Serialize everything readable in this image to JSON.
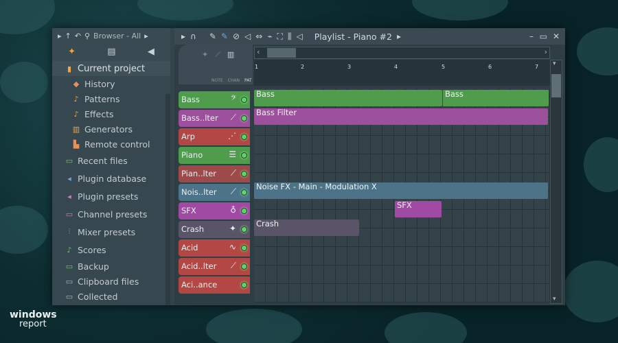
{
  "browser": {
    "label": "Browser - All",
    "items": [
      {
        "label": "Current project",
        "icon": "document-icon"
      },
      {
        "label": "History",
        "icon": "history-icon"
      },
      {
        "label": "Patterns",
        "icon": "note-icon"
      },
      {
        "label": "Effects",
        "icon": "note-icon"
      },
      {
        "label": "Generators",
        "icon": "generator-icon"
      },
      {
        "label": "Remote control",
        "icon": "remote-icon"
      },
      {
        "label": "Recent files",
        "icon": "folder-icon"
      },
      {
        "label": "Plugin database",
        "icon": "plug-icon"
      },
      {
        "label": "Plugin presets",
        "icon": "plug-icon"
      },
      {
        "label": "Channel presets",
        "icon": "channel-icon"
      },
      {
        "label": "Mixer presets",
        "icon": "mixer-icon"
      },
      {
        "label": "Scores",
        "icon": "note-icon"
      },
      {
        "label": "Backup",
        "icon": "folder-icon"
      },
      {
        "label": "Clipboard files",
        "icon": "folder-icon"
      },
      {
        "label": "Collected",
        "icon": "folder-icon"
      }
    ]
  },
  "playlist": {
    "title": "Playlist - Piano #2",
    "header_labels": [
      "NOTE",
      "CHAN",
      "PAT"
    ],
    "ruler": [
      "1",
      "2",
      "3",
      "4",
      "5",
      "6",
      "7"
    ],
    "tracks": [
      {
        "label": "Bass",
        "color": "#4f9c4d"
      },
      {
        "label": "Bass..lter",
        "color": "#9c4f9a"
      },
      {
        "label": "Arp",
        "color": "#b24744"
      },
      {
        "label": "Piano",
        "color": "#4f9c4d"
      },
      {
        "label": "Pian..lter",
        "color": "#9e4a4a"
      },
      {
        "label": "Nois..lter",
        "color": "#4d7388"
      },
      {
        "label": "SFX",
        "color": "#a14aa3"
      },
      {
        "label": "Crash",
        "color": "#5a5468"
      },
      {
        "label": "Acid",
        "color": "#b24744"
      },
      {
        "label": "Acid..lter",
        "color": "#b24744"
      },
      {
        "label": "Aci..ance",
        "color": "#b24744"
      }
    ],
    "clips": [
      {
        "label": "Bass",
        "color": "#4f9c4d"
      },
      {
        "label": "Bass",
        "color": "#4f9c4d"
      },
      {
        "label": "Bass Filter",
        "color": "#9c4f9a"
      },
      {
        "label": "Noise FX - Main - Modulation X",
        "color": "#4d7388"
      },
      {
        "label": "SFX",
        "color": "#a14aa3"
      },
      {
        "label": "Crash",
        "color": "#5a5468"
      }
    ]
  },
  "watermark": {
    "line1": "windows",
    "line2": "report"
  }
}
